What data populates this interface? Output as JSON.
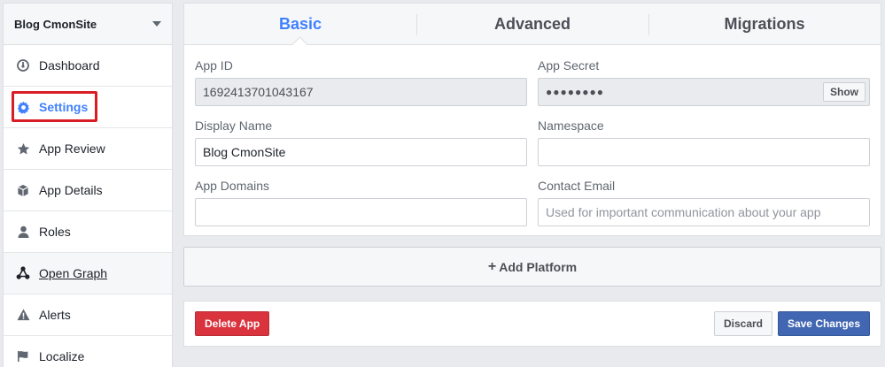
{
  "sidebar": {
    "app_name": "Blog CmonSite",
    "items": [
      {
        "label": "Dashboard",
        "icon": "dashboard-icon"
      },
      {
        "label": "Settings",
        "icon": "gear-icon"
      },
      {
        "label": "App Review",
        "icon": "star-icon"
      },
      {
        "label": "App Details",
        "icon": "cube-icon"
      },
      {
        "label": "Roles",
        "icon": "person-icon"
      },
      {
        "label": "Open Graph",
        "icon": "graph-icon"
      },
      {
        "label": "Alerts",
        "icon": "warning-icon"
      },
      {
        "label": "Localize",
        "icon": "flag-icon"
      }
    ]
  },
  "tabs": [
    {
      "label": "Basic"
    },
    {
      "label": "Advanced"
    },
    {
      "label": "Migrations"
    }
  ],
  "form": {
    "app_id_label": "App ID",
    "app_id_value": "1692413701043167",
    "app_secret_label": "App Secret",
    "app_secret_value": "●●●●●●●●",
    "show_label": "Show",
    "display_name_label": "Display Name",
    "display_name_value": "Blog CmonSite",
    "namespace_label": "Namespace",
    "namespace_value": "",
    "app_domains_label": "App Domains",
    "app_domains_value": "",
    "contact_email_label": "Contact Email",
    "contact_email_placeholder": "Used for important communication about your app"
  },
  "add_platform_label": "Add Platform",
  "footer": {
    "delete_label": "Delete App",
    "discard_label": "Discard",
    "save_label": "Save Changes"
  },
  "colors": {
    "accent": "#4080ff",
    "danger": "#d9333e",
    "primary": "#4267b2",
    "highlight": "#d91d24"
  }
}
